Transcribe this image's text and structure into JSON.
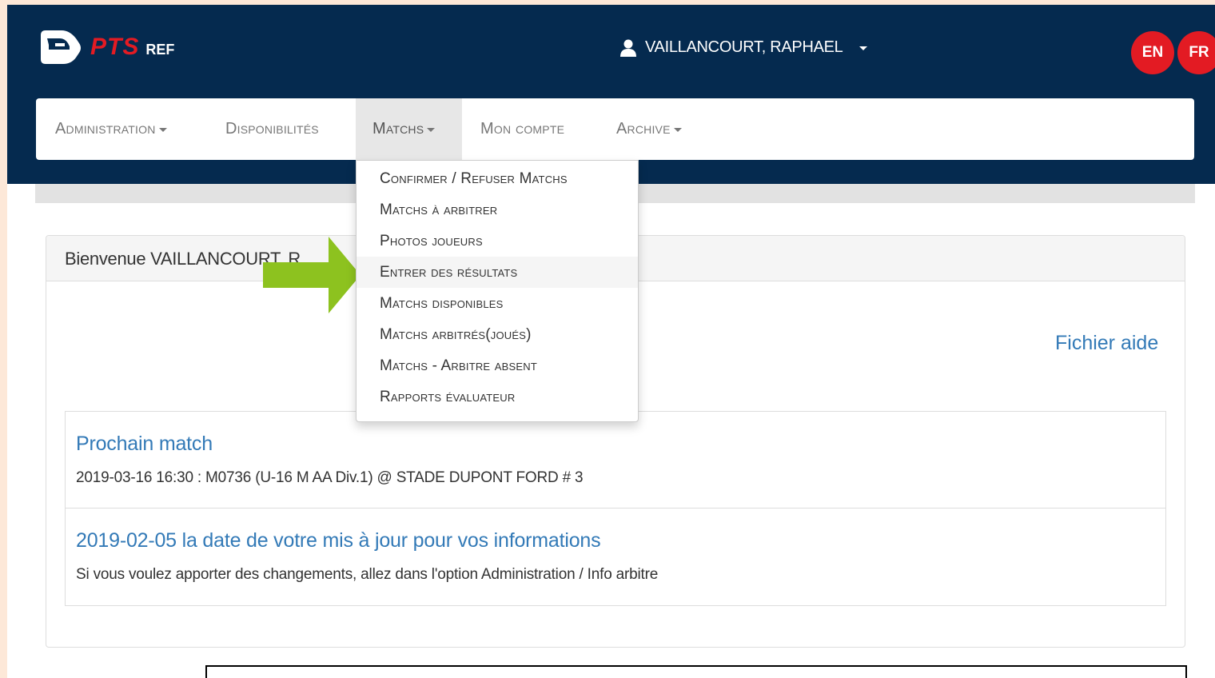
{
  "brand": {
    "name": "PTS",
    "suffix": "REF",
    "accent": "#e31b23",
    "header_bg": "#052a4f"
  },
  "user": {
    "name": "VAILLANCOURT, RAPHAEL"
  },
  "languages": [
    "EN",
    "FR"
  ],
  "nav": {
    "administration": "Administration",
    "disponibilites": "Disponibilités",
    "matchs": "Matchs",
    "mon_compte": "Mon compte",
    "archive": "Archive"
  },
  "dropdown": {
    "items": [
      "Confirmer / Refuser Matchs",
      "Matchs à arbitrer",
      "Photos joueurs",
      "Entrer des résultats",
      "Matchs disponibles",
      "Matchs arbitrés(joués)",
      "Matchs - Arbitre absent",
      "Rapports évaluateur"
    ],
    "highlighted": "Entrer des résultats"
  },
  "panel": {
    "welcome": "Bienvenue VAILLANCOURT, R",
    "help_link": "Fichier aide",
    "items": [
      {
        "title": "Prochain match",
        "text": "2019-03-16 16:30 : M0736 (U-16 M AA Div.1) @ STADE DUPONT FORD # 3"
      },
      {
        "title": "2019-02-05 la date de votre mis à jour pour vos informations",
        "text": "Si vous voulez apporter des changements, allez dans l'option Administration / Info arbitre"
      }
    ]
  },
  "annotation": {
    "arrow_color": "#8dc21f"
  }
}
